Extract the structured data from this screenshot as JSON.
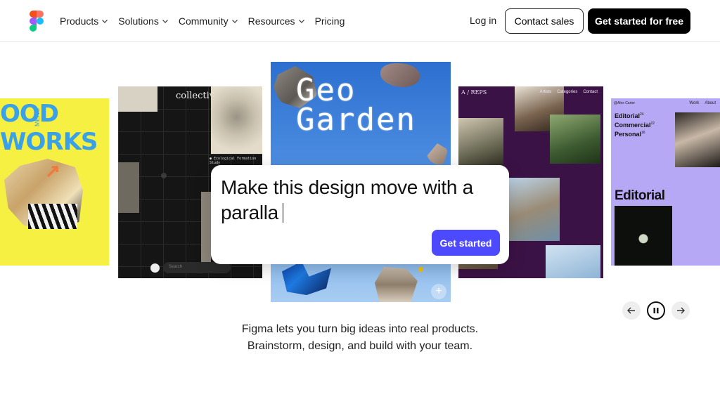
{
  "header": {
    "logo": "figma-logo",
    "nav": [
      {
        "label": "Products",
        "dropdown": true
      },
      {
        "label": "Solutions",
        "dropdown": true
      },
      {
        "label": "Community",
        "dropdown": true
      },
      {
        "label": "Resources",
        "dropdown": true
      },
      {
        "label": "Pricing",
        "dropdown": false
      }
    ],
    "login_label": "Log in",
    "contact_label": "Contact sales",
    "cta_label": "Get started for free"
  },
  "carousel": {
    "card_yellow": {
      "title": "OOD WORKS",
      "menu": "MENU"
    },
    "card_dark": {
      "title": "collectiv",
      "caption": "● Ecological Formation Study",
      "search_placeholder": "Search"
    },
    "card_sky": {
      "title_line1": "Geo",
      "title_line2": "Garden"
    },
    "card_purple": {
      "brand": "A / REPS",
      "nav": [
        "Artists",
        "Categories",
        "Contact"
      ]
    },
    "card_lilac": {
      "author": "@Alex Carter",
      "nav": [
        "Work",
        "About"
      ],
      "items": [
        {
          "label": "Editorial",
          "count": "24"
        },
        {
          "label": "Commercial",
          "count": "22"
        },
        {
          "label": "Personal",
          "count": "16"
        }
      ],
      "heading": "Editorial"
    },
    "controls": {
      "prev_icon": "arrow-left-icon",
      "pause_icon": "pause-icon",
      "next_icon": "arrow-right-icon"
    }
  },
  "prompt": {
    "text": "Make this design move with a paralla",
    "button_label": "Get started"
  },
  "tagline": {
    "line1": "Figma lets you turn big ideas into real products.",
    "line2": "Brainstorm, design, and build with your team."
  },
  "colors": {
    "accent": "#4d49fc",
    "dark_button": "#000000",
    "card_yellow": "#f5f042",
    "card_purple": "#3b1245",
    "card_lilac": "#b6a8f4"
  }
}
